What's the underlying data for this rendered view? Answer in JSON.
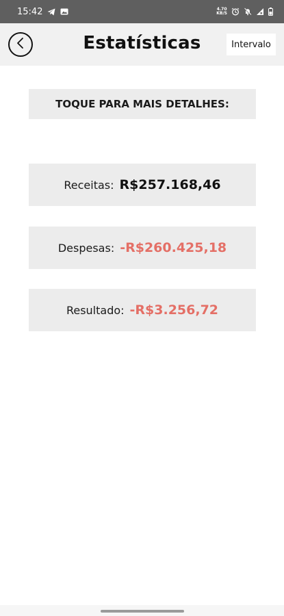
{
  "status_bar": {
    "time": "15:42",
    "net_speed_top": "4.70",
    "net_speed_bottom": "KB/S"
  },
  "header": {
    "title": "Estatísticas",
    "interval_label": "Intervalo"
  },
  "hint": {
    "text": "TOQUE PARA MAIS DETALHES:"
  },
  "stats": {
    "revenue": {
      "label": "Receitas:",
      "value": "R$257.168,46"
    },
    "expenses": {
      "label": "Despesas:",
      "value": "-R$260.425,18"
    },
    "result": {
      "label": "Resultado:",
      "value": "-R$3.256,72"
    }
  },
  "colors": {
    "negative": "#e46f66",
    "card_background": "#ececec",
    "status_bar": "#5f5f5f"
  }
}
